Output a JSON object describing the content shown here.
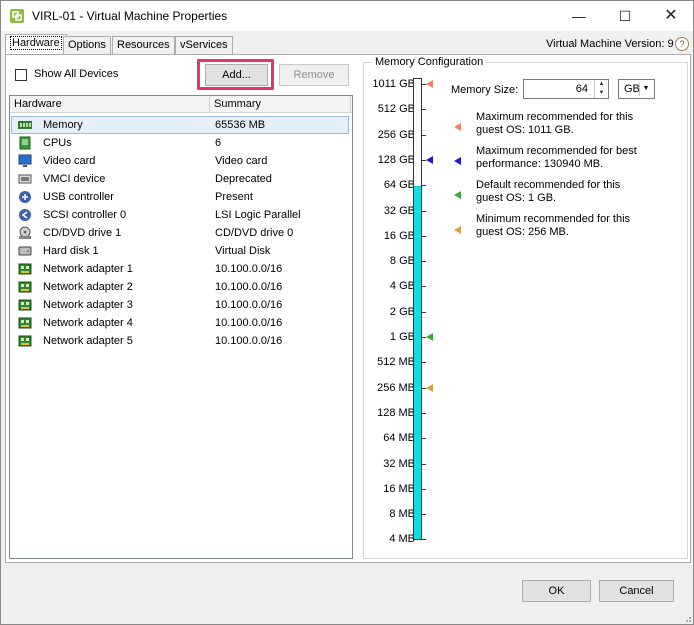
{
  "window": {
    "title": "VIRL-01 - Virtual Machine Properties",
    "buttons": {
      "minimize": "—",
      "maximize": "☐",
      "close": "✕"
    }
  },
  "tabs": [
    {
      "label": "Hardware",
      "active": true
    },
    {
      "label": "Options",
      "active": false
    },
    {
      "label": "Resources",
      "active": false
    },
    {
      "label": "vServices",
      "active": false
    }
  ],
  "vm_version": "Virtual Machine Version: 9",
  "help_glyph": "?",
  "hardware_panel": {
    "show_all_devices_label": "Show All Devices",
    "show_all_devices_checked": false,
    "add_label": "Add...",
    "remove_label": "Remove",
    "columns": [
      "Hardware",
      "Summary"
    ],
    "rows": [
      {
        "name": "Memory",
        "summary": "65536 MB",
        "icon": "memory-icon",
        "selected": true
      },
      {
        "name": "CPUs",
        "summary": "6",
        "icon": "cpu-icon"
      },
      {
        "name": "Video card",
        "summary": "Video card",
        "icon": "monitor-icon"
      },
      {
        "name": "VMCI device",
        "summary": "Deprecated",
        "icon": "vmci-icon"
      },
      {
        "name": "USB controller",
        "summary": "Present",
        "icon": "usb-icon"
      },
      {
        "name": "SCSI controller 0",
        "summary": "LSI Logic Parallel",
        "icon": "scsi-icon"
      },
      {
        "name": "CD/DVD drive 1",
        "summary": "CD/DVD drive 0",
        "icon": "cd-dvd-icon"
      },
      {
        "name": "Hard disk 1",
        "summary": "Virtual Disk",
        "icon": "hard-disk-icon"
      },
      {
        "name": "Network adapter 1",
        "summary": "10.100.0.0/16",
        "icon": "network-adapter-icon"
      },
      {
        "name": "Network adapter 2",
        "summary": "10.100.0.0/16",
        "icon": "network-adapter-icon"
      },
      {
        "name": "Network adapter 3",
        "summary": "10.100.0.0/16",
        "icon": "network-adapter-icon"
      },
      {
        "name": "Network adapter 4",
        "summary": "10.100.0.0/16",
        "icon": "network-adapter-icon"
      },
      {
        "name": "Network adapter 5",
        "summary": "10.100.0.0/16",
        "icon": "network-adapter-icon"
      }
    ]
  },
  "memory_config": {
    "group_title": "Memory Configuration",
    "memory_size_label": "Memory Size:",
    "memory_size_value": "64",
    "unit_value": "GB",
    "scale_labels": [
      "1011 GB",
      "512 GB",
      "256 GB",
      "128 GB",
      "64 GB",
      "32 GB",
      "16 GB",
      "8 GB",
      "4 GB",
      "2 GB",
      "1 GB",
      "512 MB",
      "256 MB",
      "128 MB",
      "64 MB",
      "32 MB",
      "16 MB",
      "8 MB",
      "4 MB"
    ],
    "bar_fill_label": "64 GB",
    "colors": {
      "bar_fill": "#16dce2",
      "max_marker": "#f08060",
      "best_marker": "#1a1acc",
      "default_marker": "#3aaa3a",
      "min_marker": "#d4a050"
    },
    "markers": [
      {
        "label": "1011 GB",
        "color_key": "max_marker"
      },
      {
        "label": "128 GB",
        "color_key": "best_marker"
      },
      {
        "label": "1 GB",
        "color_key": "default_marker"
      },
      {
        "label": "256 MB",
        "color_key": "min_marker"
      }
    ],
    "legend": [
      {
        "line1": "Maximum recommended for this",
        "line2": "guest OS: 1011 GB.",
        "color_key": "max_marker"
      },
      {
        "line1": "Maximum recommended for best",
        "line2": "performance: 130940 MB.",
        "color_key": "best_marker"
      },
      {
        "line1": "Default recommended for this",
        "line2": "guest OS: 1 GB.",
        "color_key": "default_marker"
      },
      {
        "line1": "Minimum recommended for this",
        "line2": "guest OS: 256 MB.",
        "color_key": "min_marker"
      }
    ]
  },
  "footer": {
    "ok_label": "OK",
    "cancel_label": "Cancel"
  }
}
